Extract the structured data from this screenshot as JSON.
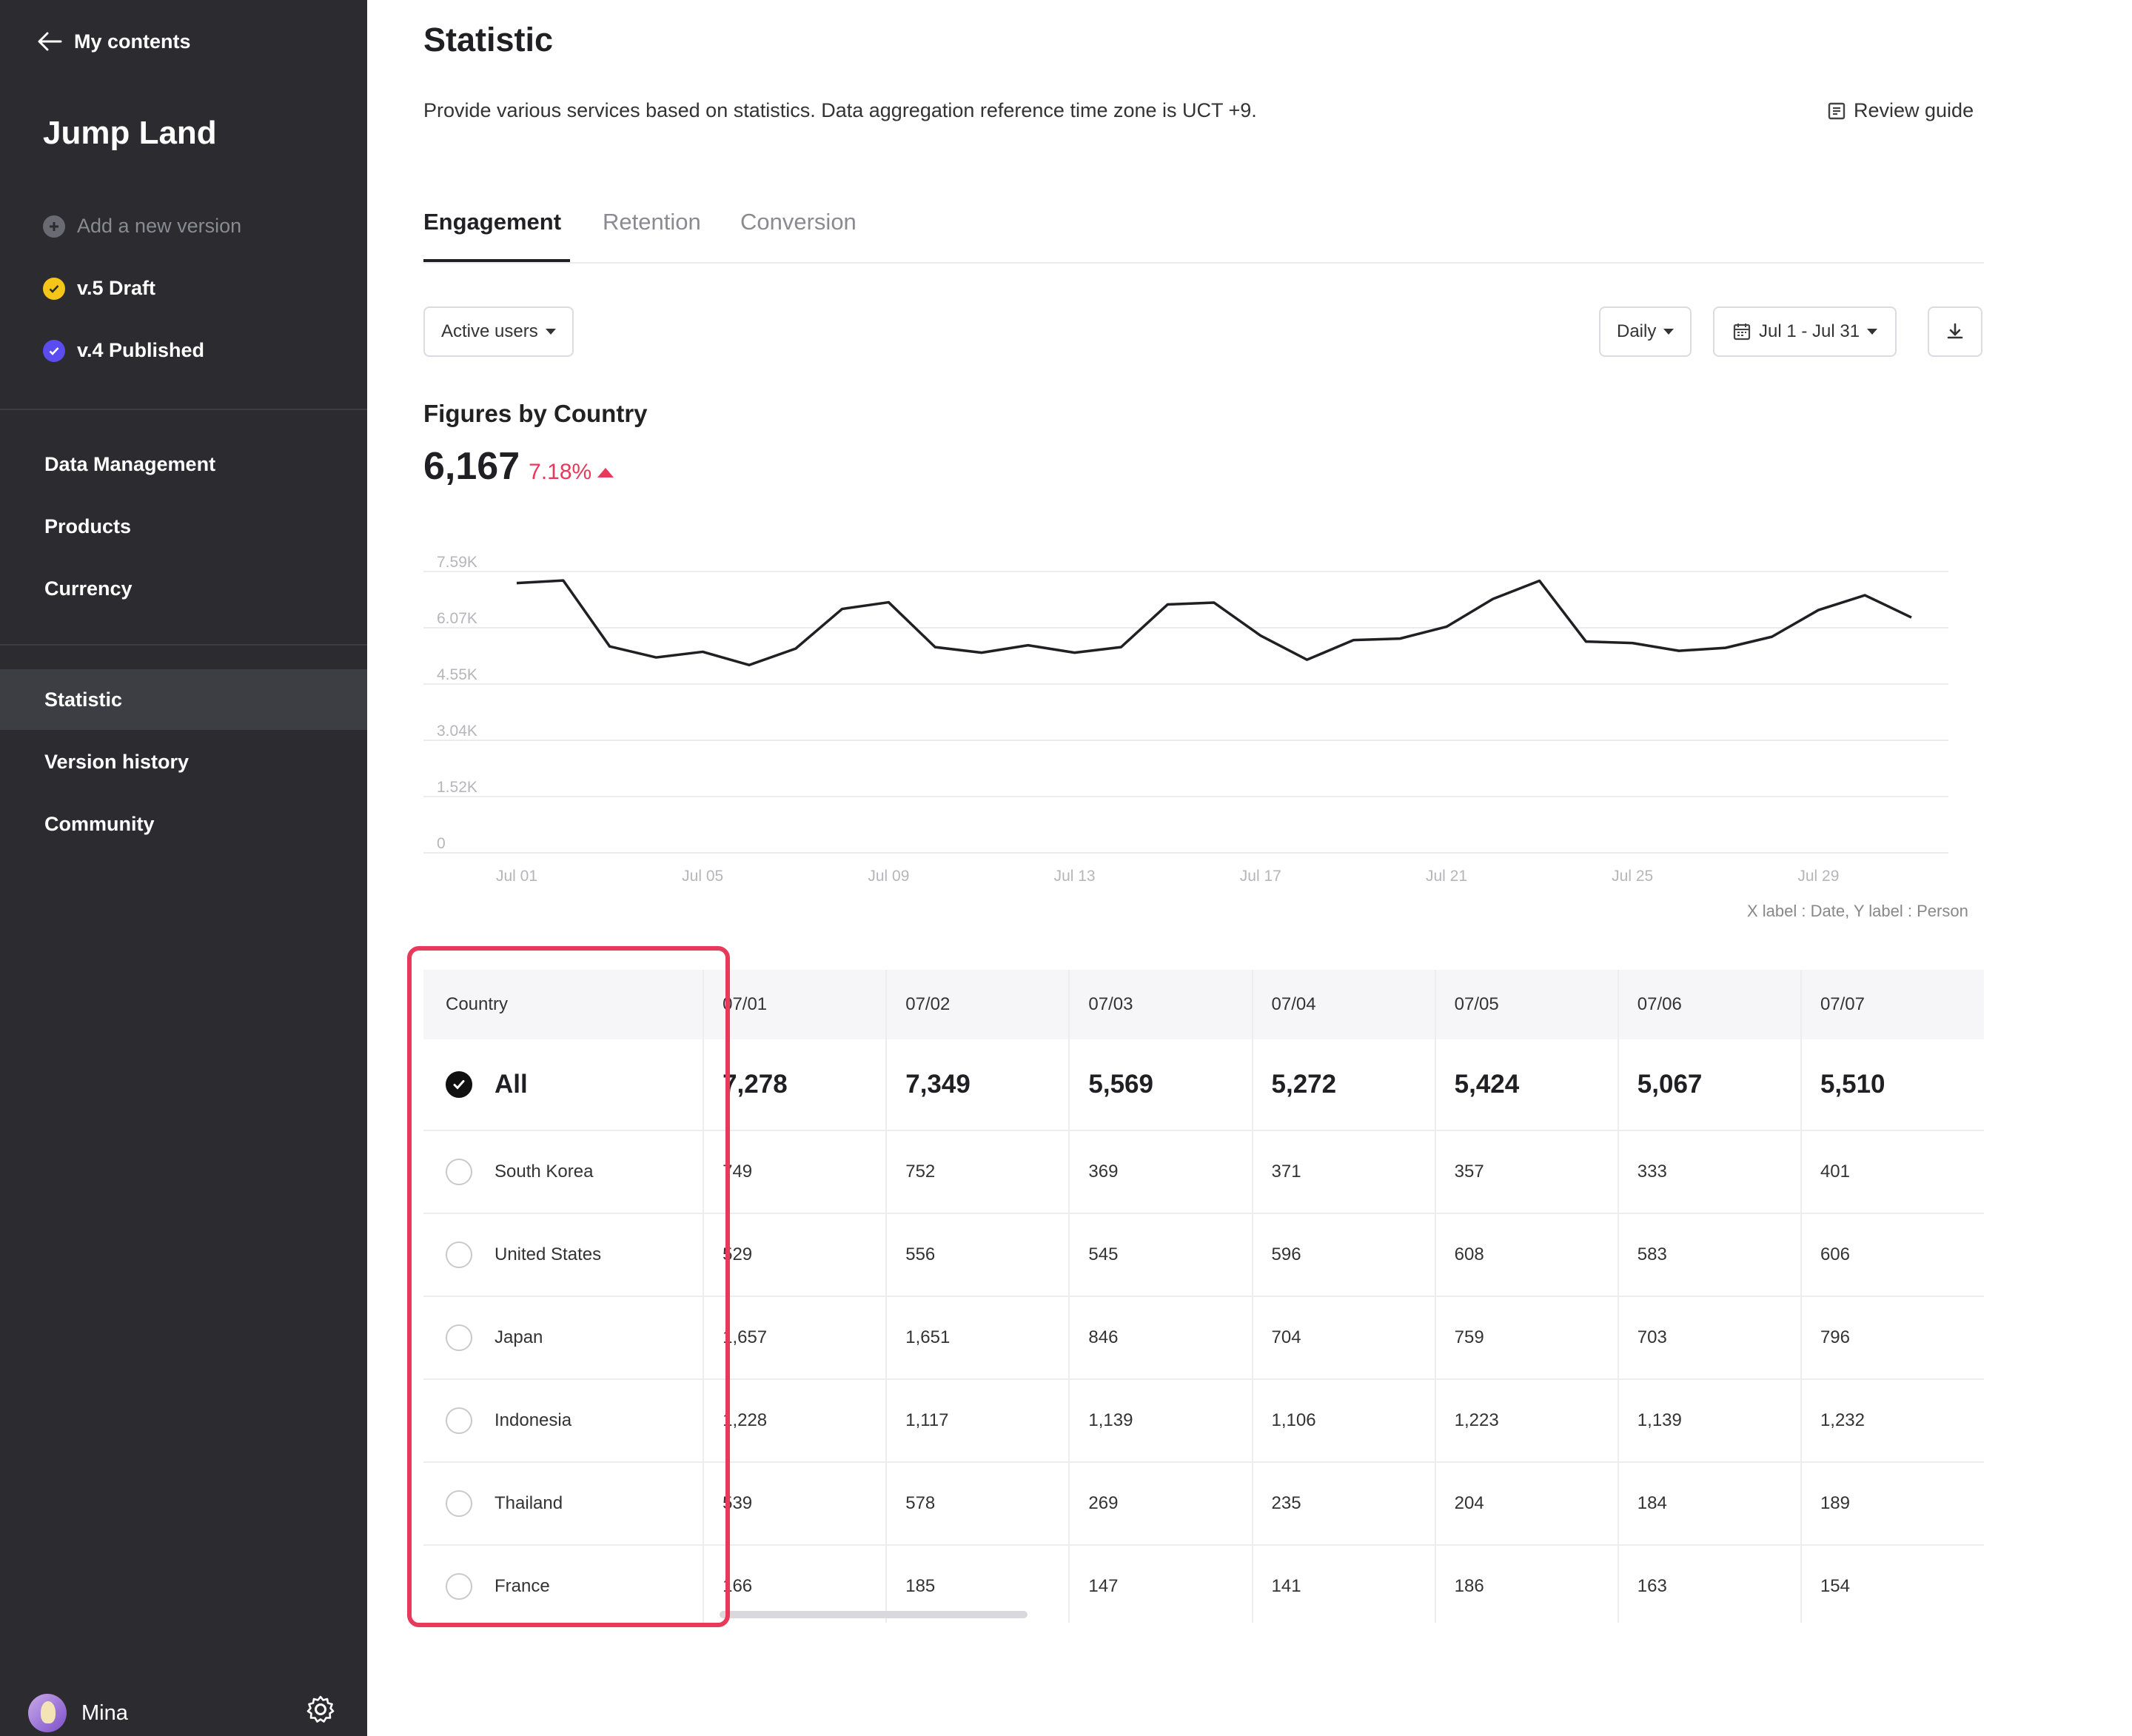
{
  "sidebar": {
    "back_label": "My contents",
    "app_title": "Jump Land",
    "versions": {
      "add_label": "Add a new version",
      "draft_label": "v.5 Draft",
      "published_label": "v.4 Published"
    },
    "nav": [
      "Data Management",
      "Products",
      "Currency",
      "Statistic",
      "Version history",
      "Community"
    ],
    "active_nav": "Statistic",
    "user_name": "Mina"
  },
  "header": {
    "title": "Statistic",
    "description": "Provide various services based on statistics. Data aggregation reference time zone is UCT +9.",
    "review_guide": "Review guide"
  },
  "tabs": [
    "Engagement",
    "Retention",
    "Conversion"
  ],
  "active_tab": "Engagement",
  "filters": {
    "metric": "Active users",
    "interval": "Daily",
    "date_range": "Jul 1 - Jul 31"
  },
  "figures": {
    "title": "Figures by Country",
    "total": "6,167",
    "change": "7.18%"
  },
  "chart_data": {
    "type": "line",
    "title": "",
    "xlabel": "Date",
    "ylabel": "Person",
    "axis_note": "X label : Date, Y label : Person",
    "x": [
      "Jul 01",
      "Jul 02",
      "Jul 03",
      "Jul 04",
      "Jul 05",
      "Jul 06",
      "Jul 07",
      "Jul 08",
      "Jul 09",
      "Jul 10",
      "Jul 11",
      "Jul 12",
      "Jul 13",
      "Jul 14",
      "Jul 15",
      "Jul 16",
      "Jul 17",
      "Jul 18",
      "Jul 19",
      "Jul 20",
      "Jul 21",
      "Jul 22",
      "Jul 23",
      "Jul 24",
      "Jul 25",
      "Jul 26",
      "Jul 27",
      "Jul 28",
      "Jul 29",
      "Jul 30",
      "Jul 31"
    ],
    "x_tick_labels": [
      "Jul 01",
      "Jul 05",
      "Jul 09",
      "Jul 13",
      "Jul 17",
      "Jul 21",
      "Jul 25",
      "Jul 29"
    ],
    "y_tick_labels": [
      "7.59K",
      "6.07K",
      "4.55K",
      "3.04K",
      "1.52K",
      "0"
    ],
    "ylim": [
      0,
      7590
    ],
    "series": [
      {
        "values": [
          7278,
          7349,
          5569,
          5272,
          5424,
          5067,
          5510,
          6580,
          6760,
          5550,
          5400,
          5600,
          5400,
          5550,
          6700,
          6750,
          5860,
          5210,
          5740,
          5780,
          6100,
          6850,
          7340,
          5700,
          5660,
          5450,
          5530,
          5830,
          6550,
          6950,
          6350
        ]
      }
    ],
    "grid": true,
    "color": "#1f1f24"
  },
  "table": {
    "country_header": "Country",
    "dates": [
      "07/01",
      "07/02",
      "07/03",
      "07/04",
      "07/05",
      "07/06",
      "07/07"
    ],
    "all": {
      "label": "All",
      "values": [
        "7,278",
        "7,349",
        "5,569",
        "5,272",
        "5,424",
        "5,067",
        "5,510"
      ]
    },
    "rows": [
      {
        "country": "South Korea",
        "values": [
          "749",
          "752",
          "369",
          "371",
          "357",
          "333",
          "401"
        ]
      },
      {
        "country": "United States",
        "values": [
          "529",
          "556",
          "545",
          "596",
          "608",
          "583",
          "606"
        ]
      },
      {
        "country": "Japan",
        "values": [
          "1,657",
          "1,651",
          "846",
          "704",
          "759",
          "703",
          "796"
        ]
      },
      {
        "country": "Indonesia",
        "values": [
          "1,228",
          "1,117",
          "1,139",
          "1,106",
          "1,223",
          "1,139",
          "1,232"
        ]
      },
      {
        "country": "Thailand",
        "values": [
          "539",
          "578",
          "269",
          "235",
          "204",
          "184",
          "189"
        ]
      },
      {
        "country": "France",
        "values": [
          "166",
          "185",
          "147",
          "141",
          "186",
          "163",
          "154"
        ]
      }
    ]
  },
  "colors": {
    "sidebar_bg": "#2b2b30",
    "accent_red": "#e8395a",
    "draft_dot": "#f5c518",
    "published_dot": "#5b4cf0"
  }
}
